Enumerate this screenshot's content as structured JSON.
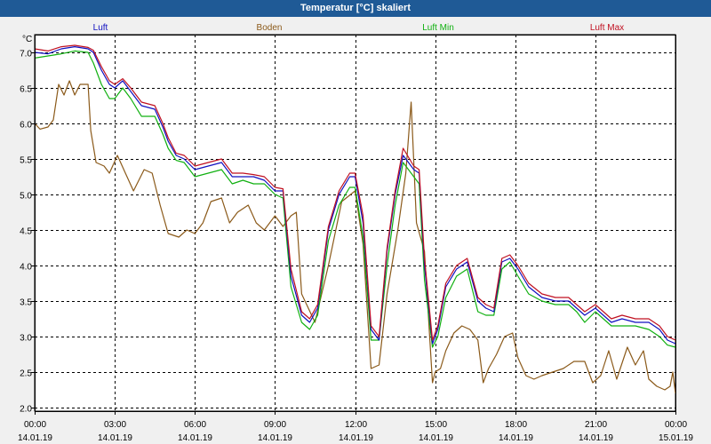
{
  "window": {
    "title": "Temperatur [°C] skaliert"
  },
  "chart_data": {
    "type": "line",
    "title": "Temperatur [°C] skaliert",
    "ylabel": "°C",
    "xlabel": "",
    "ylim": [
      1.95,
      7.25
    ],
    "xlim": [
      0,
      24
    ],
    "grid": true,
    "y_ticks": [
      "2.0",
      "2.5",
      "3.0",
      "3.5",
      "4.0",
      "4.5",
      "5.0",
      "5.5",
      "6.0",
      "6.5",
      "7.0"
    ],
    "x_ticks": [
      {
        "time": "00:00",
        "date": "14.01.19"
      },
      {
        "time": "03:00",
        "date": "14.01.19"
      },
      {
        "time": "06:00",
        "date": "14.01.19"
      },
      {
        "time": "09:00",
        "date": "14.01.19"
      },
      {
        "time": "12:00",
        "date": "14.01.19"
      },
      {
        "time": "15:00",
        "date": "14.01.19"
      },
      {
        "time": "18:00",
        "date": "14.01.19"
      },
      {
        "time": "21:00",
        "date": "14.01.19"
      },
      {
        "time": "00:00",
        "date": "15.01.19"
      }
    ],
    "series": [
      {
        "name": "Luft",
        "color": "#1010c0",
        "x": [
          0,
          0.5,
          1,
          1.5,
          2,
          2.2,
          2.5,
          2.8,
          3.0,
          3.3,
          3.6,
          4.0,
          4.5,
          4.8,
          5.0,
          5.3,
          5.6,
          6.0,
          6.5,
          7.0,
          7.4,
          7.8,
          8.2,
          8.6,
          9.0,
          9.3,
          9.6,
          10.0,
          10.3,
          10.6,
          11.0,
          11.4,
          11.8,
          12.0,
          12.3,
          12.6,
          12.9,
          13.2,
          13.5,
          13.8,
          14.2,
          14.4,
          14.6,
          14.9,
          15.1,
          15.4,
          15.8,
          16.2,
          16.6,
          16.9,
          17.2,
          17.5,
          17.8,
          18.1,
          18.5,
          19.0,
          19.5,
          20.0,
          20.3,
          20.6,
          21.0,
          21.3,
          21.6,
          22.0,
          22.5,
          23.0,
          23.4,
          23.7,
          24
        ],
        "y": [
          7.0,
          6.98,
          7.05,
          7.08,
          7.05,
          7.0,
          6.75,
          6.55,
          6.5,
          6.6,
          6.45,
          6.25,
          6.2,
          5.95,
          5.75,
          5.55,
          5.5,
          5.35,
          5.4,
          5.45,
          5.25,
          5.25,
          5.25,
          5.2,
          5.05,
          5.05,
          3.85,
          3.3,
          3.2,
          3.4,
          4.5,
          5.0,
          5.25,
          5.25,
          4.6,
          3.1,
          2.95,
          4.2,
          5.0,
          5.55,
          5.35,
          5.3,
          4.0,
          2.9,
          3.1,
          3.7,
          3.95,
          4.05,
          3.5,
          3.4,
          3.35,
          4.05,
          4.1,
          3.95,
          3.7,
          3.55,
          3.5,
          3.5,
          3.4,
          3.3,
          3.4,
          3.3,
          3.2,
          3.25,
          3.2,
          3.2,
          3.1,
          2.95,
          2.9
        ]
      },
      {
        "name": "Boden",
        "color": "#8b5a1a",
        "x": [
          0,
          0.2,
          0.5,
          0.7,
          0.9,
          1.1,
          1.3,
          1.5,
          1.7,
          1.9,
          2.0,
          2.1,
          2.3,
          2.6,
          2.8,
          3.1,
          3.4,
          3.7,
          4.1,
          4.4,
          4.7,
          5.0,
          5.4,
          5.7,
          6.0,
          6.3,
          6.6,
          7.0,
          7.3,
          7.6,
          8.0,
          8.3,
          8.6,
          9.0,
          9.3,
          9.6,
          9.8,
          10.0,
          10.5,
          11.0,
          11.5,
          12.0,
          12.3,
          12.6,
          12.9,
          13.2,
          13.6,
          13.9,
          14.1,
          14.3,
          14.6,
          14.9,
          15.0,
          15.2,
          15.4,
          15.7,
          16.0,
          16.3,
          16.6,
          16.8,
          17.0,
          17.3,
          17.6,
          17.9,
          18.1,
          18.4,
          18.7,
          19.0,
          19.4,
          19.8,
          20.2,
          20.6,
          20.9,
          21.2,
          21.5,
          21.8,
          22.2,
          22.5,
          22.8,
          23.0,
          23.3,
          23.6,
          23.8,
          23.9,
          24
        ],
        "y": [
          6.0,
          5.92,
          5.95,
          6.05,
          6.55,
          6.4,
          6.6,
          6.4,
          6.55,
          6.55,
          6.55,
          5.9,
          5.45,
          5.4,
          5.3,
          5.55,
          5.3,
          5.05,
          5.35,
          5.3,
          4.85,
          4.45,
          4.4,
          4.5,
          4.45,
          4.6,
          4.9,
          4.95,
          4.6,
          4.75,
          4.85,
          4.6,
          4.5,
          4.7,
          4.55,
          4.7,
          4.75,
          3.6,
          3.2,
          4.0,
          4.9,
          5.05,
          4.3,
          2.55,
          2.6,
          3.6,
          4.5,
          5.3,
          6.3,
          4.6,
          4.2,
          2.35,
          2.5,
          2.55,
          2.8,
          3.05,
          3.15,
          3.1,
          2.95,
          2.35,
          2.55,
          2.75,
          3.0,
          3.05,
          2.7,
          2.45,
          2.4,
          2.45,
          2.5,
          2.55,
          2.65,
          2.65,
          2.35,
          2.45,
          2.8,
          2.4,
          2.85,
          2.6,
          2.8,
          2.4,
          2.3,
          2.25,
          2.3,
          2.5,
          2.2
        ]
      },
      {
        "name": "Luft Min",
        "color": "#10b010",
        "x": [
          0,
          0.5,
          1,
          1.5,
          2,
          2.2,
          2.5,
          2.8,
          3.0,
          3.3,
          3.6,
          4.0,
          4.5,
          4.8,
          5.0,
          5.3,
          5.6,
          6.0,
          6.5,
          7.0,
          7.4,
          7.8,
          8.2,
          8.6,
          9.0,
          9.3,
          9.6,
          10.0,
          10.3,
          10.6,
          11.0,
          11.4,
          11.8,
          12.0,
          12.3,
          12.6,
          12.9,
          13.2,
          13.5,
          13.8,
          14.2,
          14.4,
          14.6,
          14.9,
          15.1,
          15.4,
          15.8,
          16.2,
          16.6,
          16.9,
          17.2,
          17.5,
          17.8,
          18.1,
          18.5,
          19.0,
          19.5,
          20.0,
          20.3,
          20.6,
          21.0,
          21.3,
          21.6,
          22.0,
          22.5,
          23.0,
          23.4,
          23.7,
          24
        ],
        "y": [
          6.92,
          6.95,
          6.98,
          7.02,
          7.0,
          6.85,
          6.55,
          6.35,
          6.35,
          6.5,
          6.35,
          6.1,
          6.1,
          5.85,
          5.65,
          5.48,
          5.45,
          5.25,
          5.3,
          5.35,
          5.15,
          5.2,
          5.15,
          5.15,
          5.0,
          4.95,
          3.7,
          3.2,
          3.1,
          3.3,
          4.35,
          4.85,
          5.1,
          5.1,
          4.4,
          2.95,
          2.95,
          4.0,
          4.85,
          5.45,
          5.25,
          5.15,
          3.8,
          2.85,
          3.0,
          3.55,
          3.85,
          3.95,
          3.35,
          3.3,
          3.3,
          3.95,
          4.05,
          3.85,
          3.6,
          3.5,
          3.45,
          3.45,
          3.35,
          3.2,
          3.35,
          3.25,
          3.15,
          3.15,
          3.15,
          3.1,
          3.0,
          2.88,
          2.85
        ]
      },
      {
        "name": "Luft Max",
        "color": "#c01020",
        "x": [
          0,
          0.5,
          1,
          1.5,
          2,
          2.2,
          2.5,
          2.8,
          3.0,
          3.3,
          3.6,
          4.0,
          4.5,
          4.8,
          5.0,
          5.3,
          5.6,
          6.0,
          6.5,
          7.0,
          7.4,
          7.8,
          8.2,
          8.6,
          9.0,
          9.3,
          9.6,
          10.0,
          10.3,
          10.6,
          11.0,
          11.4,
          11.8,
          12.0,
          12.3,
          12.6,
          12.9,
          13.2,
          13.5,
          13.8,
          14.2,
          14.4,
          14.6,
          14.9,
          15.1,
          15.4,
          15.8,
          16.2,
          16.6,
          16.9,
          17.2,
          17.5,
          17.8,
          18.1,
          18.5,
          19.0,
          19.5,
          20.0,
          20.3,
          20.6,
          21.0,
          21.3,
          21.6,
          22.0,
          22.5,
          23.0,
          23.4,
          23.7,
          24
        ],
        "y": [
          7.05,
          7.02,
          7.08,
          7.1,
          7.07,
          7.03,
          6.8,
          6.6,
          6.55,
          6.63,
          6.5,
          6.3,
          6.25,
          6.0,
          5.8,
          5.58,
          5.55,
          5.4,
          5.45,
          5.5,
          5.3,
          5.3,
          5.28,
          5.25,
          5.1,
          5.08,
          3.95,
          3.35,
          3.25,
          3.45,
          4.55,
          5.05,
          5.3,
          5.3,
          4.7,
          3.15,
          3.0,
          4.25,
          5.05,
          5.65,
          5.4,
          5.35,
          4.1,
          2.95,
          3.15,
          3.75,
          4.0,
          4.1,
          3.55,
          3.45,
          3.4,
          4.1,
          4.15,
          4.0,
          3.75,
          3.6,
          3.55,
          3.55,
          3.45,
          3.35,
          3.45,
          3.35,
          3.25,
          3.3,
          3.25,
          3.25,
          3.15,
          3.0,
          2.95
        ]
      }
    ]
  }
}
